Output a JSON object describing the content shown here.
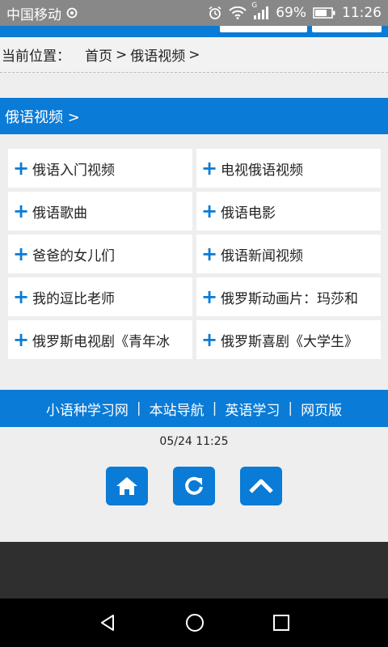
{
  "statusbar": {
    "carrier": "中国移动",
    "network": "G",
    "battery": "69%",
    "time": "11:26"
  },
  "breadcrumb": {
    "label": "当前位置：",
    "home": "首页",
    "sep1": ">",
    "current": "俄语视频",
    "sep2": ">"
  },
  "section": {
    "title": "俄语视频 >"
  },
  "categories": [
    "俄语入门视频",
    "电视俄语视频",
    "俄语歌曲",
    "俄语电影",
    "爸爸的女儿们",
    "俄语新闻视频",
    "我的逗比老师",
    "俄罗斯动画片：玛莎和",
    "俄罗斯电视剧《青年冰",
    "俄罗斯喜剧《大学生》"
  ],
  "footer": {
    "links": [
      "小语种学习网",
      "本站导航",
      "英语学习",
      "网页版"
    ],
    "separator": "|"
  },
  "timestamp": "05/24 11:25",
  "actions": {
    "home_icon": "home-icon",
    "refresh_icon": "refresh-icon",
    "top_icon": "chevron-up-icon"
  },
  "colors": {
    "accent": "#0a7bd6",
    "statusbar": "#888888"
  }
}
